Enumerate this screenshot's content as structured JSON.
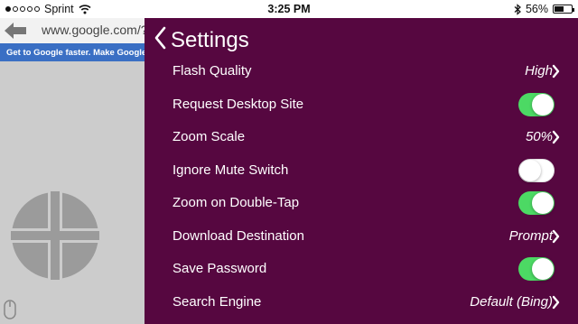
{
  "status_bar": {
    "carrier": "Sprint",
    "time": "3:25 PM",
    "battery": "56%",
    "signal_bars_filled": 1,
    "signal_bars_total": 5,
    "battery_level": 0.56
  },
  "browser": {
    "url": "www.google.com/?",
    "promo_text": "Get to Google faster. Make Google your"
  },
  "settings": {
    "title": "Settings",
    "rows": [
      {
        "label": "Flash Quality",
        "kind": "value",
        "value": "High"
      },
      {
        "label": "Request Desktop Site",
        "kind": "toggle",
        "on": true
      },
      {
        "label": "Zoom Scale",
        "kind": "value",
        "value": "50%"
      },
      {
        "label": "Ignore Mute Switch",
        "kind": "toggle",
        "on": false
      },
      {
        "label": "Zoom on Double-Tap",
        "kind": "toggle",
        "on": true
      },
      {
        "label": "Download Destination",
        "kind": "value",
        "value": "Prompt"
      },
      {
        "label": "Save Password",
        "kind": "toggle",
        "on": true
      },
      {
        "label": "Search Engine",
        "kind": "value",
        "value": "Default (Bing)"
      }
    ]
  },
  "colors": {
    "panel_bg": "#560740",
    "toggle_on": "#4cd964",
    "promo_bg": "#3a6fc4"
  },
  "icons": {
    "back": "chevron-left-icon",
    "disclosure": "chevron-right-icon",
    "browser_back": "arrow-left-icon",
    "wifi": "wifi-icon",
    "bluetooth": "bluetooth-icon",
    "battery": "battery-icon",
    "dpad": "dpad-icon",
    "mouse": "mouse-icon"
  }
}
